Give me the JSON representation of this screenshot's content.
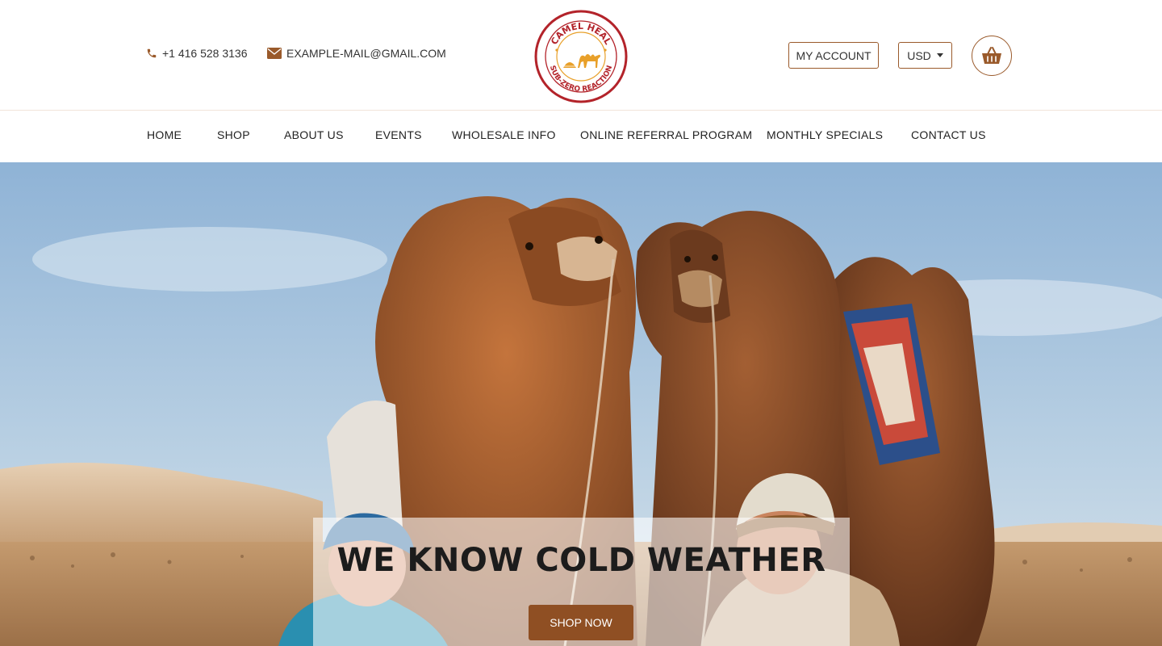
{
  "header": {
    "phone": "+1 416 528 3136",
    "email": "EXAMPLE-MAIL@GMAIL.COM",
    "logo_text_top": "CAMEL HEAL",
    "logo_text_bottom": "SUB-ZERO REACTION",
    "account_label": "MY ACCOUNT",
    "currency": "USD"
  },
  "nav": {
    "items": [
      {
        "label": "HOME"
      },
      {
        "label": "SHOP"
      },
      {
        "label": "ABOUT US"
      },
      {
        "label": "EVENTS"
      },
      {
        "label": "WHOLESALE INFO"
      },
      {
        "label": "ONLINE REFERRAL PROGRAM"
      },
      {
        "label": "MONTHLY SPECIALS"
      },
      {
        "label": "CONTACT US"
      }
    ]
  },
  "hero": {
    "headline": "WE KNOW COLD WEATHER",
    "cta_label": "SHOP NOW"
  },
  "colors": {
    "accent": "#8f4f23",
    "logo_red": "#b3232a",
    "logo_gold": "#e8a02a"
  },
  "icons": {
    "phone": "phone-icon",
    "email": "envelope-icon",
    "cart": "shopping-basket-icon",
    "currency": "caret-down-icon"
  }
}
